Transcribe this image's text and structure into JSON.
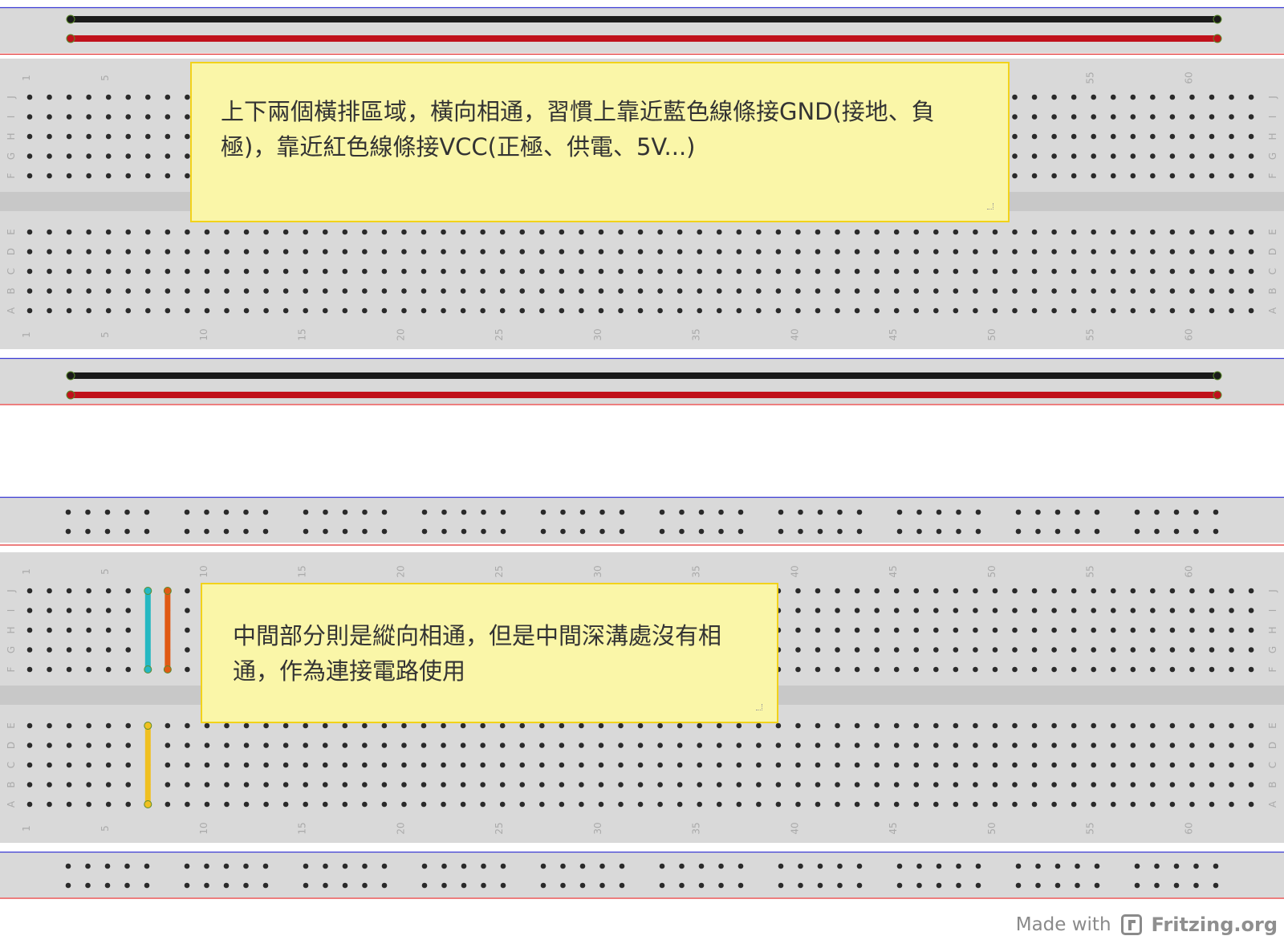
{
  "notes": {
    "top": "上下兩個橫排區域，橫向相通，習慣上靠近藍色線條接GND(接地、負極)，靠近紅色線條接VCC(正極、供電、5V...)",
    "bottom": "中間部分則是縱向相通，但是中間深溝處沒有相通，作為連接電路使用"
  },
  "row_letters_top": [
    "J",
    "I",
    "H",
    "G",
    "F"
  ],
  "row_letters_bottom": [
    "E",
    "D",
    "C",
    "B",
    "A"
  ],
  "column_labels": [
    "1",
    "5",
    "10",
    "15",
    "20",
    "25",
    "30",
    "35",
    "40",
    "45",
    "50",
    "55",
    "60"
  ],
  "colors": {
    "board": "#d9d9d9",
    "groove": "#c8c8c8",
    "rail_blue": "#3b3bd6",
    "rail_red": "#e03030",
    "wire_black": "#1a1a1a",
    "wire_red": "#c0111b",
    "wire_cyan": "#25b8c2",
    "wire_orange": "#e05a14",
    "wire_yellow": "#f0c020",
    "note_bg": "#faf6a8",
    "note_border": "#f2d21a"
  },
  "footer": {
    "made_with": "Made with",
    "brand": "Fritzing.org"
  }
}
